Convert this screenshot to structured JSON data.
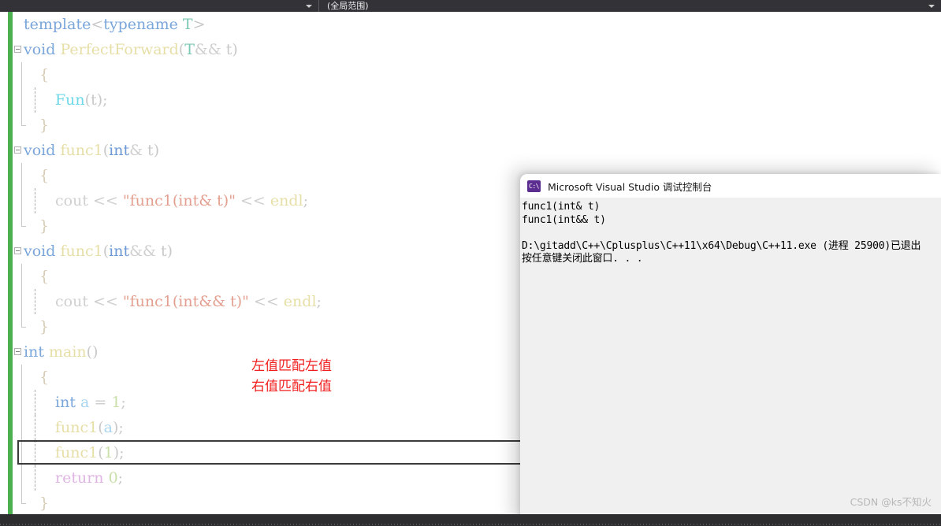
{
  "navbar": {
    "scope_label": "(全局范围)",
    "left_caret_icon": "chevron-down-icon",
    "right_caret_icon": "chevron-down-icon"
  },
  "editor": {
    "language": "C++",
    "change_bar_color": "#4caf50",
    "lines": [
      {
        "indent": 0,
        "tokens": [
          {
            "t": "template",
            "c": "t-kw"
          },
          {
            "t": "<",
            "c": "t-punc"
          },
          {
            "t": "typename",
            "c": "t-kw"
          },
          {
            "t": " ",
            "c": "t-plain"
          },
          {
            "t": "T",
            "c": "t-type"
          },
          {
            "t": ">",
            "c": "t-punc"
          }
        ]
      },
      {
        "indent": 0,
        "fold": true,
        "tokens": [
          {
            "t": "void",
            "c": "t-kw"
          },
          {
            "t": " ",
            "c": "t-plain"
          },
          {
            "t": "PerfectForward",
            "c": "t-fn"
          },
          {
            "t": "(",
            "c": "t-punc"
          },
          {
            "t": "T",
            "c": "t-type"
          },
          {
            "t": "&& ",
            "c": "t-op"
          },
          {
            "t": "t",
            "c": "t-punc"
          },
          {
            "t": ")",
            "c": "t-punc"
          }
        ]
      },
      {
        "indent": 1,
        "guide": "solid",
        "tokens": [
          {
            "t": "{",
            "c": "t-brace"
          }
        ]
      },
      {
        "indent": 2,
        "guide": "solid",
        "iguide": true,
        "tokens": [
          {
            "t": "Fun",
            "c": "t-fn2"
          },
          {
            "t": "(",
            "c": "t-punc"
          },
          {
            "t": "t",
            "c": "t-punc"
          },
          {
            "t": ");",
            "c": "t-punc"
          }
        ]
      },
      {
        "indent": 1,
        "guide": "endcap",
        "tokens": [
          {
            "t": "}",
            "c": "t-brace"
          }
        ]
      },
      {
        "indent": 0,
        "fold": true,
        "tokens": [
          {
            "t": "void",
            "c": "t-kw"
          },
          {
            "t": " ",
            "c": "t-plain"
          },
          {
            "t": "func1",
            "c": "t-fn"
          },
          {
            "t": "(",
            "c": "t-punc"
          },
          {
            "t": "int",
            "c": "t-kw2"
          },
          {
            "t": "& ",
            "c": "t-op"
          },
          {
            "t": "t",
            "c": "t-punc"
          },
          {
            "t": ")",
            "c": "t-punc"
          }
        ]
      },
      {
        "indent": 1,
        "guide": "solid",
        "tokens": [
          {
            "t": "{",
            "c": "t-brace"
          }
        ]
      },
      {
        "indent": 2,
        "guide": "solid",
        "iguide": true,
        "tokens": [
          {
            "t": "cout",
            "c": "t-plain"
          },
          {
            "t": " << ",
            "c": "t-op"
          },
          {
            "t": "\"func1(int& t)\"",
            "c": "t-str"
          },
          {
            "t": " << ",
            "c": "t-op"
          },
          {
            "t": "endl",
            "c": "t-endl"
          },
          {
            "t": ";",
            "c": "t-punc"
          }
        ]
      },
      {
        "indent": 1,
        "guide": "endcap",
        "tokens": [
          {
            "t": "}",
            "c": "t-brace"
          }
        ]
      },
      {
        "indent": 0,
        "fold": true,
        "tokens": [
          {
            "t": "void",
            "c": "t-kw"
          },
          {
            "t": " ",
            "c": "t-plain"
          },
          {
            "t": "func1",
            "c": "t-fn"
          },
          {
            "t": "(",
            "c": "t-punc"
          },
          {
            "t": "int",
            "c": "t-kw2"
          },
          {
            "t": "&& ",
            "c": "t-op"
          },
          {
            "t": "t",
            "c": "t-punc"
          },
          {
            "t": ")",
            "c": "t-punc"
          }
        ]
      },
      {
        "indent": 1,
        "guide": "solid",
        "tokens": [
          {
            "t": "{",
            "c": "t-brace"
          }
        ]
      },
      {
        "indent": 2,
        "guide": "solid",
        "iguide": true,
        "tokens": [
          {
            "t": "cout",
            "c": "t-plain"
          },
          {
            "t": " << ",
            "c": "t-op"
          },
          {
            "t": "\"func1(int&& t)\"",
            "c": "t-str"
          },
          {
            "t": " << ",
            "c": "t-op"
          },
          {
            "t": "endl",
            "c": "t-endl"
          },
          {
            "t": ";",
            "c": "t-punc"
          }
        ]
      },
      {
        "indent": 1,
        "guide": "endcap",
        "tokens": [
          {
            "t": "}",
            "c": "t-brace"
          }
        ]
      },
      {
        "indent": 0,
        "fold": true,
        "tokens": [
          {
            "t": "int",
            "c": "t-kw"
          },
          {
            "t": " ",
            "c": "t-plain"
          },
          {
            "t": "main",
            "c": "t-fn"
          },
          {
            "t": "()",
            "c": "t-punc"
          }
        ]
      },
      {
        "indent": 1,
        "guide": "solid",
        "tokens": [
          {
            "t": "{",
            "c": "t-brace"
          }
        ]
      },
      {
        "indent": 2,
        "guide": "solid",
        "iguide": true,
        "tokens": [
          {
            "t": "int",
            "c": "t-kw"
          },
          {
            "t": " ",
            "c": "t-plain"
          },
          {
            "t": "a",
            "c": "t-var"
          },
          {
            "t": " = ",
            "c": "t-op"
          },
          {
            "t": "1",
            "c": "t-num"
          },
          {
            "t": ";",
            "c": "t-punc"
          }
        ]
      },
      {
        "indent": 2,
        "guide": "solid",
        "iguide": true,
        "tokens": [
          {
            "t": "func1",
            "c": "t-fn"
          },
          {
            "t": "(",
            "c": "t-punc"
          },
          {
            "t": "a",
            "c": "t-var"
          },
          {
            "t": ");",
            "c": "t-punc"
          }
        ]
      },
      {
        "indent": 2,
        "guide": "solid",
        "iguide": true,
        "highlight": true,
        "tokens": [
          {
            "t": "func1",
            "c": "t-fn"
          },
          {
            "t": "(",
            "c": "t-punc"
          },
          {
            "t": "1",
            "c": "t-num"
          },
          {
            "t": ");",
            "c": "t-punc"
          }
        ]
      },
      {
        "indent": 2,
        "guide": "solid",
        "iguide": true,
        "tokens": [
          {
            "t": "return",
            "c": "t-ret"
          },
          {
            "t": " ",
            "c": "t-plain"
          },
          {
            "t": "0",
            "c": "t-num"
          },
          {
            "t": ";",
            "c": "t-punc"
          }
        ]
      },
      {
        "indent": 1,
        "guide": "endcap",
        "tokens": [
          {
            "t": "}",
            "c": "t-brace"
          }
        ]
      }
    ],
    "annotations": {
      "color": "#f01e1e",
      "lines": [
        "左值匹配左值",
        "右值匹配右值"
      ]
    }
  },
  "console": {
    "title": "Microsoft Visual Studio 调试控制台",
    "icon": "console-window-icon",
    "output": [
      "func1(int& t)",
      "func1(int&& t)",
      "",
      "D:\\gitadd\\C++\\Cplusplus\\C++11\\x64\\Debug\\C++11.exe (进程 25900)已退出",
      "按任意键关闭此窗口. . ."
    ]
  },
  "watermark": {
    "text": "CSDN @ks不知火"
  }
}
